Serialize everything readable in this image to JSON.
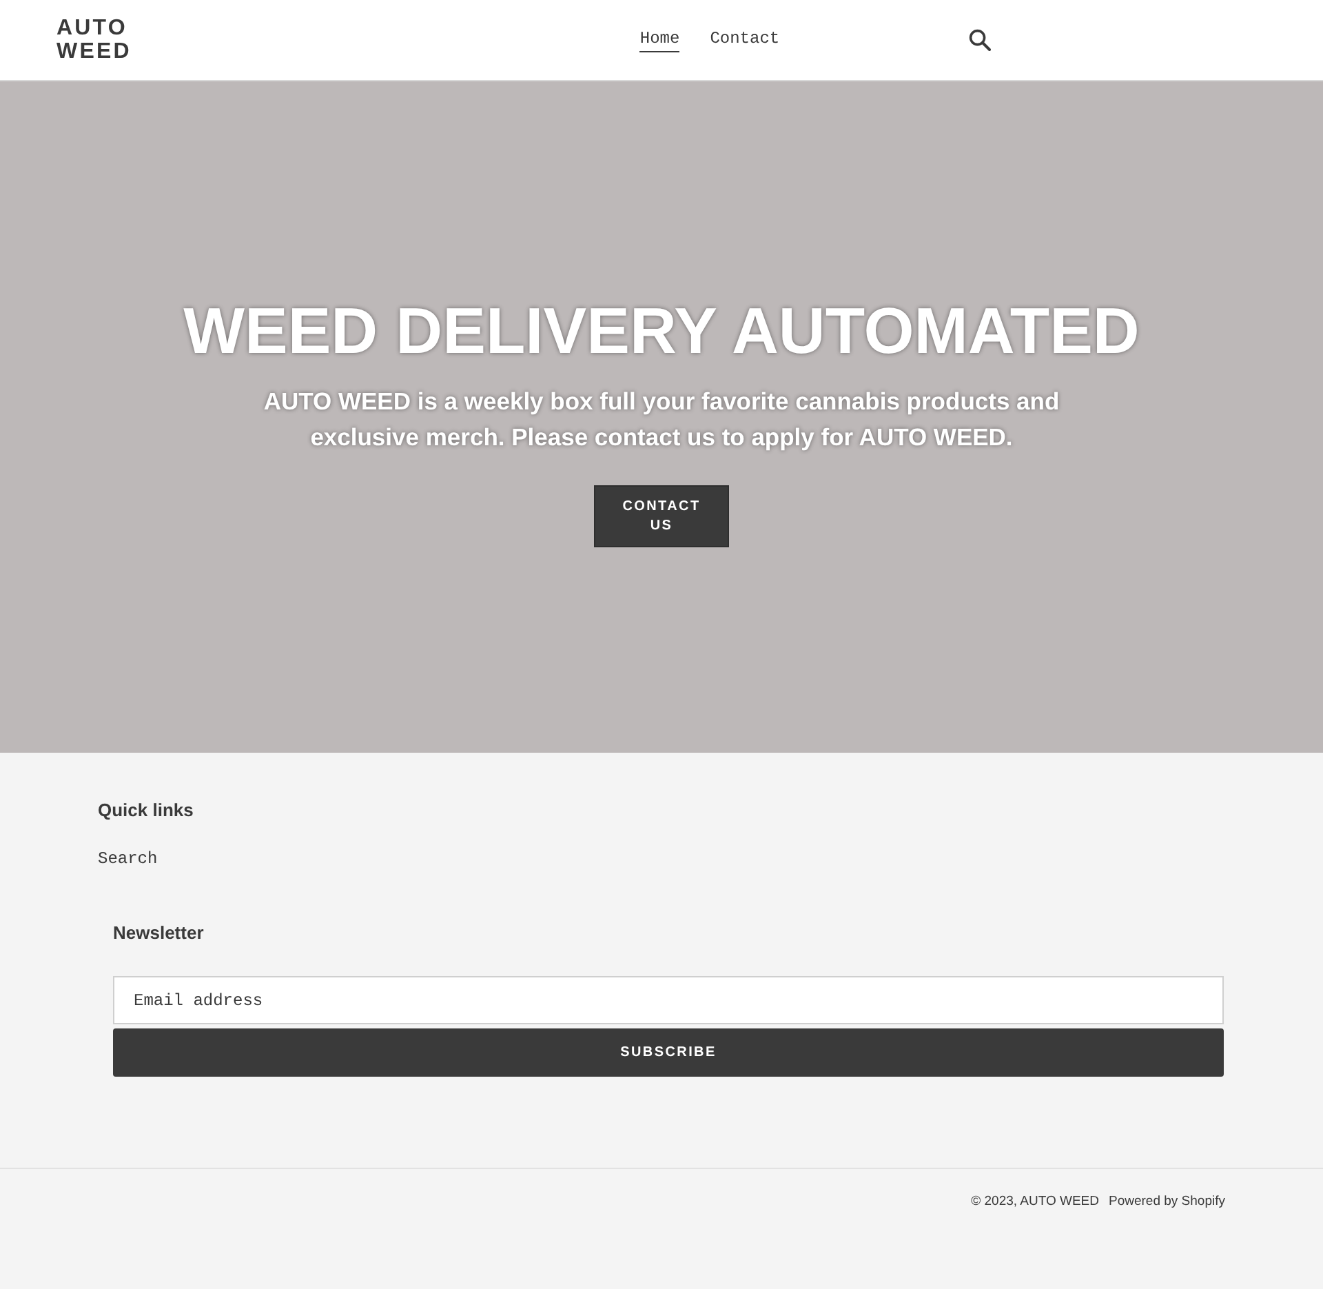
{
  "header": {
    "logo": "AUTO WEED",
    "nav": [
      {
        "label": "Home",
        "selected": true
      },
      {
        "label": "Contact",
        "selected": false
      }
    ]
  },
  "hero": {
    "title": "WEED DELIVERY AUTOMATED",
    "text": "AUTO WEED is a weekly box full your favorite cannabis products and exclusive merch. Please contact us to apply for AUTO WEED.",
    "button": "CONTACT US"
  },
  "footer": {
    "quick_links": {
      "title": "Quick links",
      "links": [
        "Search"
      ]
    },
    "newsletter": {
      "title": "Newsletter",
      "email": {
        "placeholder": "Email address"
      },
      "button": "SUBSCRIBE"
    },
    "copyright": "© 2023, AUTO WEED",
    "powered_by": "Powered by Shopify"
  }
}
